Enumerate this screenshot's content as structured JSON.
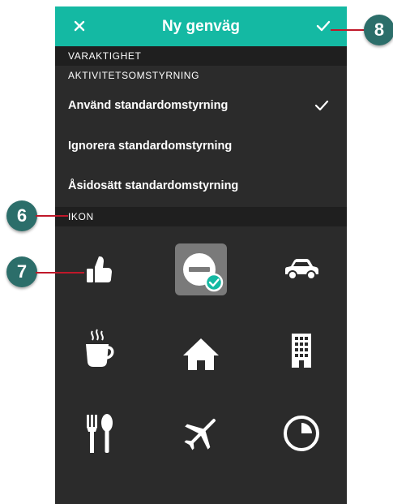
{
  "topbar": {
    "title": "Ny genväg",
    "close_icon": "close-icon",
    "confirm_icon": "check-icon",
    "background": "#14b9a3"
  },
  "sections": {
    "duration_header": "VARAKTIGHET",
    "activity_header": "AKTIVITETSOMSTYRNING",
    "icon_header": "IKON"
  },
  "options": [
    {
      "label": "Använd standardomstyrning",
      "selected": true
    },
    {
      "label": "Ignorera standardomstyrning",
      "selected": false
    },
    {
      "label": "Åsidosätt standardomstyrning",
      "selected": false
    }
  ],
  "icons": [
    {
      "name": "thumbs-up-icon",
      "selected": false
    },
    {
      "name": "do-not-disturb-icon",
      "selected": true
    },
    {
      "name": "car-icon",
      "selected": false
    },
    {
      "name": "coffee-cup-icon",
      "selected": false
    },
    {
      "name": "home-icon",
      "selected": false
    },
    {
      "name": "office-building-icon",
      "selected": false
    },
    {
      "name": "fork-spoon-icon",
      "selected": false
    },
    {
      "name": "airplane-icon",
      "selected": false
    },
    {
      "name": "clock-pie-icon",
      "selected": false
    }
  ],
  "callouts": {
    "badge_6": "6",
    "badge_7": "7",
    "badge_8": "8",
    "badge_color": "#2c6e6a",
    "line_color": "#c0182a"
  }
}
